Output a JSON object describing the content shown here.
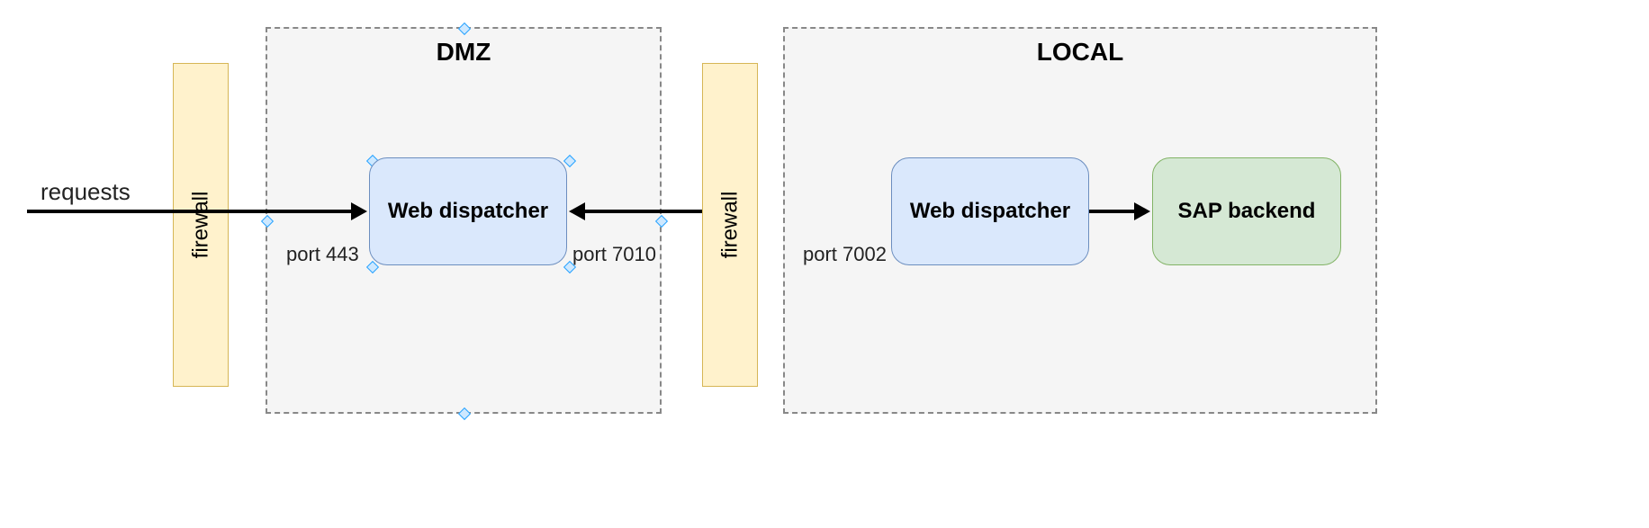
{
  "requests_label": "requests",
  "firewall1_label": "firewall",
  "firewall2_label": "firewall",
  "dmz": {
    "title": "DMZ",
    "webdispatcher_label": "Web dispatcher",
    "port_left": "port 443",
    "port_right": "port 7010"
  },
  "local": {
    "title": "LOCAL",
    "webdispatcher_label": "Web dispatcher",
    "sapbackend_label": "SAP backend",
    "port_left": "port 7002"
  },
  "diagram": {
    "nodes": [
      {
        "id": "requests",
        "type": "source",
        "label": "requests"
      },
      {
        "id": "firewall1",
        "type": "firewall",
        "label": "firewall"
      },
      {
        "id": "dmz_zone",
        "type": "zone",
        "label": "DMZ"
      },
      {
        "id": "wd1",
        "type": "web-dispatcher",
        "zone": "DMZ",
        "label": "Web dispatcher",
        "port_in": 443,
        "port_out": 7010
      },
      {
        "id": "firewall2",
        "type": "firewall",
        "label": "firewall"
      },
      {
        "id": "local_zone",
        "type": "zone",
        "label": "LOCAL"
      },
      {
        "id": "wd2",
        "type": "web-dispatcher",
        "zone": "LOCAL",
        "label": "Web dispatcher",
        "port_in": 7002
      },
      {
        "id": "sap",
        "type": "sap-backend",
        "zone": "LOCAL",
        "label": "SAP backend"
      }
    ],
    "edges": [
      {
        "from": "requests",
        "to": "wd1",
        "direction": "right",
        "through": "firewall1"
      },
      {
        "from": "firewall2",
        "to": "wd1",
        "direction": "left"
      },
      {
        "from": "wd2",
        "to": "sap",
        "direction": "right"
      }
    ]
  }
}
